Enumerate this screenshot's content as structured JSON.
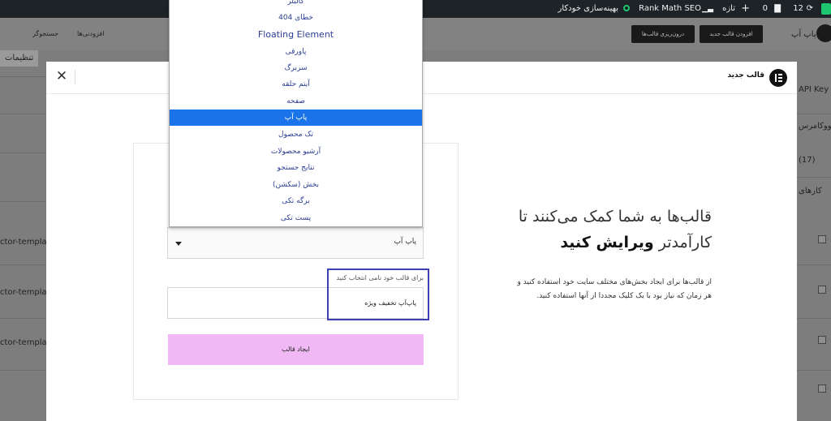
{
  "adminbar": {
    "notif_count": "12",
    "comments_count": "0",
    "new_label": "تازه",
    "seo_label": "Rank Math SEO",
    "optimize_label": "بهینه‌سازی خودکار"
  },
  "background": {
    "page_title": "پاپ آپ",
    "add_button": "افزودن قالب جدید",
    "import_button": "درون‌ریزی قالب‌ها",
    "tools_label": "افزودنی‌ها",
    "search_label": "جستجوگر",
    "settings_tab": "تنظیمات",
    "api_key_label": "API Key",
    "woocommerce_label": "ووکامرس",
    "count_label": "(17)",
    "templates_label": "کارهای",
    "template_slug_1": "ctor-template",
    "template_slug_2": "ctor-template",
    "template_slug_3": "ctor-template"
  },
  "modal": {
    "title": "قالب جدید",
    "promo_title_line1": "قالب‌ها به شما کمک می‌کنند تا",
    "promo_title_line2_normal": "کارآمدتر",
    "promo_title_line2_bold": "ویرایش کنید",
    "promo_desc": "از قالب‌ها برای ایجاد بخش‌های مختلف سایت خود استفاده کنید و هر زمان که نیاز بود با یک کلیک مجددا از آنها استفاده کنید.",
    "select_value": "پاپ آپ",
    "name_label": "برای قالب خود نامی انتخاب کنید",
    "name_value": "پاپ‌آپ تخفیف ویژه",
    "create_button": "ایجاد قالب"
  },
  "dropdown": {
    "items": [
      {
        "label": "کالبلر"
      },
      {
        "label": "خطای 404"
      },
      {
        "label": "Floating Element"
      },
      {
        "label": "پاورقی"
      },
      {
        "label": "سربرگ"
      },
      {
        "label": "آیتم حلقه"
      },
      {
        "label": "صفحه"
      },
      {
        "label": "پاپ آپ"
      },
      {
        "label": "تک محصول"
      },
      {
        "label": "آرشیو محصولات"
      },
      {
        "label": "نتایج جستجو"
      },
      {
        "label": "بخش (سکشن)"
      },
      {
        "label": "برگه تکی"
      },
      {
        "label": "پست تکی"
      }
    ],
    "selected": "پاپ آپ"
  }
}
